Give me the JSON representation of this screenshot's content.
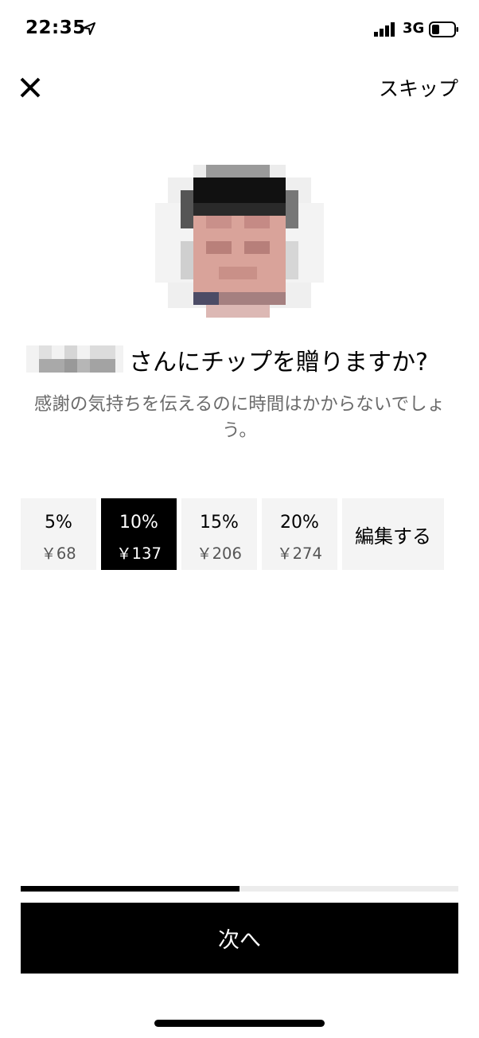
{
  "status_bar": {
    "time": "22:35",
    "network": "3G",
    "icons": [
      "location-arrow-icon",
      "signal-bars-icon",
      "battery-icon"
    ]
  },
  "header": {
    "close_icon": "close-icon",
    "skip_label": "スキップ"
  },
  "prompt": {
    "title": "さんにチップを贈りますか?",
    "subtitle": "感謝の気持ちを伝えるのに時間はかからないでしょう。"
  },
  "tip_options": [
    {
      "percent": "5%",
      "amount": "￥68",
      "selected": false
    },
    {
      "percent": "10%",
      "amount": "￥137",
      "selected": true
    },
    {
      "percent": "15%",
      "amount": "￥206",
      "selected": false
    },
    {
      "percent": "20%",
      "amount": "￥274",
      "selected": false
    }
  ],
  "edit_label": "編集する",
  "progress": {
    "fraction": 0.5
  },
  "next_label": "次へ",
  "colors": {
    "accent": "#000000",
    "option_bg": "#f4f4f4",
    "muted_text": "#6b6b6b"
  }
}
